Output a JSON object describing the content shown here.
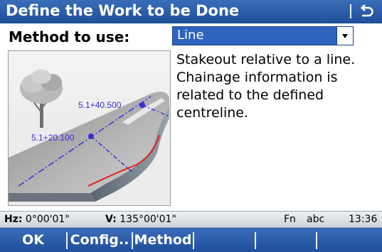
{
  "window": {
    "title": "Define the Work to be Done",
    "back_icon": "back-arrow-icon"
  },
  "method": {
    "label": "Method to use:",
    "selected": "Line"
  },
  "illustration": {
    "label_far": "5.1+40.500",
    "label_near": "5.1+20.100",
    "line_color": "#3b2fd6",
    "edge_line_color": "#e0201a"
  },
  "description": "Stakeout relative to a line. Chainage information is related to the defined centreline.",
  "status": {
    "hz_label": "Hz:",
    "hz_value": "0°00'01\"",
    "v_label": "V:",
    "v_value": "135°00'01\"",
    "fn": "Fn",
    "input_mode": "abc",
    "time": "13:36"
  },
  "softkeys": {
    "ok": "OK",
    "config": "Config..",
    "method": "Method"
  },
  "colors": {
    "bar_blue": "#2a5aa8",
    "select_blue": "#2f63c0"
  }
}
